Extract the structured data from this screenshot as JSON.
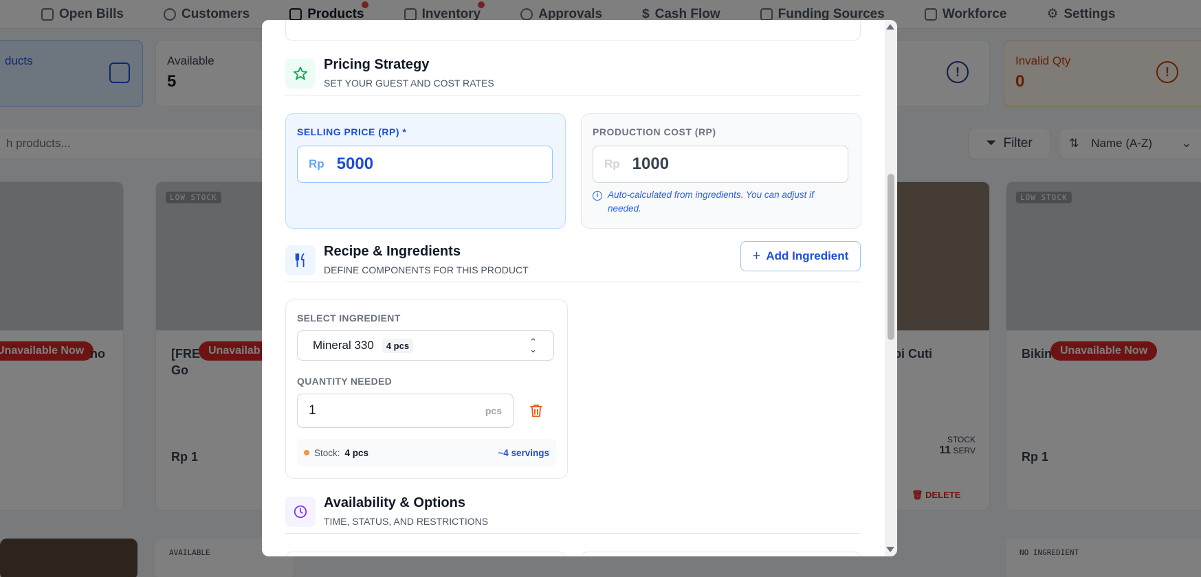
{
  "nav": {
    "items": [
      {
        "label": "Open Bills",
        "icon": "bill-icon"
      },
      {
        "label": "Customers",
        "icon": "user-circle-icon"
      },
      {
        "label": "Products",
        "icon": "cube-icon"
      },
      {
        "label": "Inventory",
        "icon": "warehouse-icon"
      },
      {
        "label": "Approvals",
        "icon": "check-circle-icon"
      },
      {
        "label": "Cash Flow",
        "icon": "dollar-icon"
      },
      {
        "label": "Funding Sources",
        "icon": "bank-icon"
      },
      {
        "label": "Workforce",
        "icon": "briefcase-icon"
      },
      {
        "label": "Settings",
        "icon": "gear-icon"
      }
    ]
  },
  "stats": {
    "products_label": "ducts",
    "available_label": "Available",
    "available_value": "5",
    "invalid_label": "Invalid Qty",
    "invalid_value": "0"
  },
  "toolbar": {
    "search_placeholder": "h products...",
    "filter_label": "Filter",
    "sort_label": "Name (A-Z)"
  },
  "cards": {
    "c1": {
      "badge": "Unavailable Now",
      "name_tail": "no"
    },
    "c2": {
      "tag": "LOW STOCK",
      "name": "[FRE",
      "name2": "Go",
      "badge": "Unavailab",
      "price": "Rp 1"
    },
    "c3": {
      "name": "pi Cuti",
      "stock_label": "STOCK",
      "stock_value": "11",
      "stock_unit": "SERV",
      "delete": "DELETE"
    },
    "c4": {
      "tag": "LOW STOCK",
      "name": "Bikin",
      "badge": "Unavailable Now",
      "price": "Rp 1"
    },
    "row2_tags": [
      "AVAILABLE",
      "NO INGREDIENT"
    ]
  },
  "modal": {
    "pricing": {
      "title": "Pricing Strategy",
      "subtitle": "SET YOUR GUEST AND COST RATES",
      "selling_label": "SELLING PRICE (RP) *",
      "selling_currency": "Rp",
      "selling_value": "5000",
      "cost_label": "PRODUCTION COST (RP)",
      "cost_currency": "Rp",
      "cost_value": "1000",
      "cost_note": "Auto-calculated from ingredients. You can adjust if needed."
    },
    "recipe": {
      "title": "Recipe & Ingredients",
      "subtitle": "DEFINE COMPONENTS FOR THIS PRODUCT",
      "add_button": "Add Ingredient",
      "select_label": "SELECT INGREDIENT",
      "ingredient_name": "Mineral 330",
      "ingredient_badge": "4 pcs",
      "qty_label": "QUANTITY NEEDED",
      "qty_value": "1",
      "qty_unit": "pcs",
      "stock_label": "Stock:",
      "stock_value": "4 pcs",
      "servings": "~4 servings"
    },
    "availability": {
      "title": "Availability & Options",
      "subtitle": "TIME, STATUS, AND RESTRICTIONS"
    }
  },
  "colors": {
    "accent": "#1d4ed8",
    "danger": "#dc2626",
    "warning": "#c2410c"
  }
}
